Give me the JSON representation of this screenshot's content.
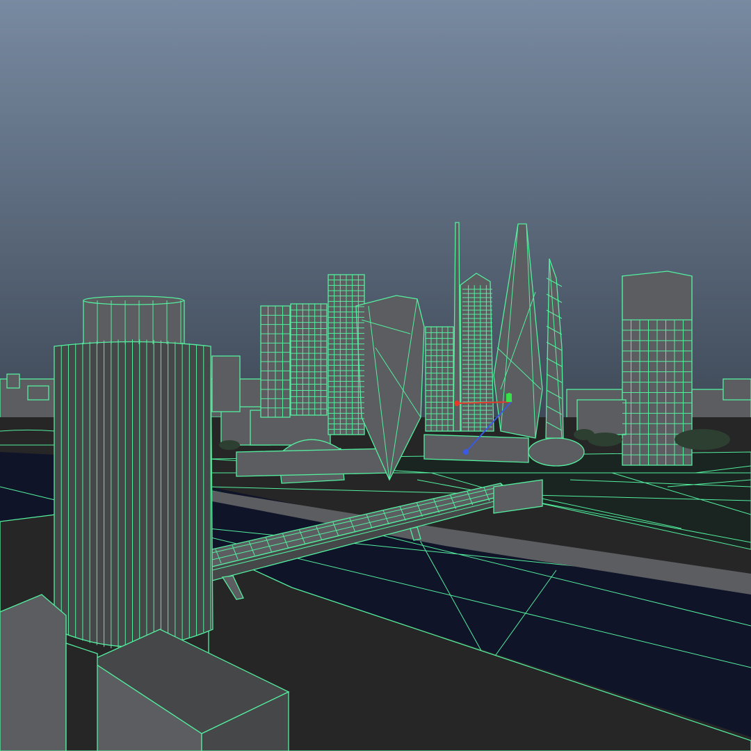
{
  "viewport": {
    "label": "",
    "shading_mode": "wireframe-on-shaded",
    "background": {
      "top_color": "#788aa1",
      "bottom_color": "#3f4a58"
    },
    "wire_color": "#54f0a0",
    "water_color": "#101428",
    "ground_color": "#262626",
    "building_fill": "#5b5d60",
    "building_fill_dark": "#454749",
    "tree_color": "#2d3f30",
    "manipulator": {
      "x_axis_color": "#e53a2a",
      "y_axis_color": "#38e04a",
      "z_axis_color": "#3a5ae5"
    }
  }
}
